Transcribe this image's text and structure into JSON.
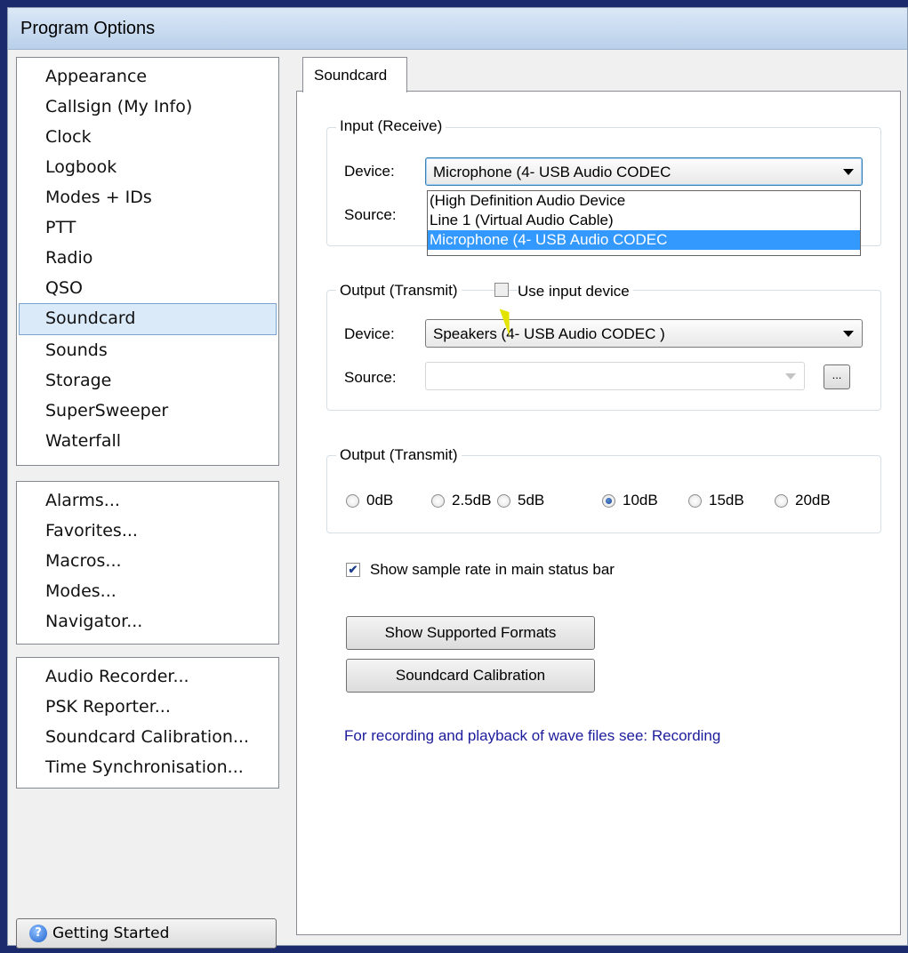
{
  "window": {
    "title": "Program Options"
  },
  "nav": {
    "options": [
      "Appearance",
      "Callsign (My Info)",
      "Clock",
      "Logbook",
      "Modes + IDs",
      "PTT",
      "Radio",
      "QSO",
      "Soundcard",
      "Sounds",
      "Storage",
      "SuperSweeper",
      "Waterfall"
    ],
    "selected": "Soundcard",
    "windows": [
      "Alarms...",
      "Favorites...",
      "Macros...",
      "Modes...",
      "Navigator..."
    ],
    "tools": [
      "Audio Recorder...",
      "PSK Reporter...",
      "Soundcard Calibration...",
      "Time Synchronisation..."
    ],
    "getting_started": "Getting Started"
  },
  "tab": {
    "label": "Soundcard"
  },
  "input": {
    "legend": "Input (Receive)",
    "device_label": "Device:",
    "device_value": "Microphone (4- USB Audio CODEC",
    "source_label": "Source:",
    "dropdown_options": [
      " (High Definition Audio Device",
      "Line 1 (Virtual Audio Cable)",
      "Microphone (4- USB Audio CODEC"
    ],
    "dropdown_highlight": 2
  },
  "output": {
    "legend": "Output (Transmit)",
    "use_input_label": "Use input device",
    "use_input_checked": false,
    "device_label": "Device:",
    "device_value": "Speakers (4- USB Audio CODEC )",
    "source_label": "Source:",
    "source_value": "",
    "browse_label": "..."
  },
  "gain": {
    "legend": "Output (Transmit)",
    "options": [
      "0dB",
      "2.5dB",
      "5dB",
      "10dB",
      "15dB",
      "20dB"
    ],
    "selected": "10dB"
  },
  "show_sample_rate": {
    "label": "Show sample rate in main status bar",
    "checked": true
  },
  "buttons": {
    "formats": "Show Supported Formats",
    "calibration": "Soundcard Calibration"
  },
  "note": "For recording and playback of wave files see: Recording",
  "colors": {
    "highlight": "#3399ff",
    "link": "#1c1c9c",
    "selection": "#dbeaf9"
  }
}
